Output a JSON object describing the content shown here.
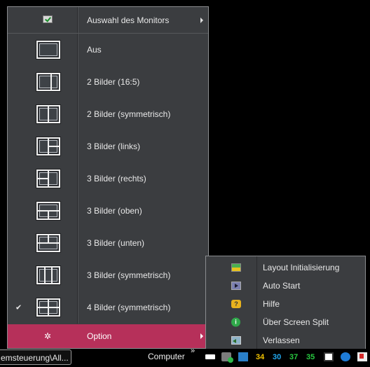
{
  "menu": {
    "header": {
      "label": "Auswahl des Monitors"
    },
    "items": [
      {
        "label": "Aus",
        "icon": "layout-off-icon",
        "checked": false
      },
      {
        "label": "2 Bilder (16:5)",
        "icon": "layout-2-wide-icon",
        "checked": false
      },
      {
        "label": "2 Bilder (symmetrisch)",
        "icon": "layout-2-sym-icon",
        "checked": false
      },
      {
        "label": "3 Bilder (links)",
        "icon": "layout-3-left-icon",
        "checked": false
      },
      {
        "label": "3 Bilder (rechts)",
        "icon": "layout-3-right-icon",
        "checked": false
      },
      {
        "label": "3 Bilder (oben)",
        "icon": "layout-3-top-icon",
        "checked": false
      },
      {
        "label": "3 Bilder (unten)",
        "icon": "layout-3-bottom-icon",
        "checked": false
      },
      {
        "label": "3 Bilder (symmetrisch)",
        "icon": "layout-3-sym-icon",
        "checked": false
      },
      {
        "label": "4 Bilder (symmetrisch)",
        "icon": "layout-4-sym-icon",
        "checked": true,
        "check_mark": "✔"
      }
    ],
    "option": {
      "label": "Option"
    },
    "colors": {
      "background": "#3b3d40",
      "highlight": "#b6305a"
    }
  },
  "submenu": {
    "items": [
      {
        "label": "Layout Initialisierung",
        "icon": "layout-init-icon"
      },
      {
        "label": "Auto Start",
        "icon": "play-icon"
      },
      {
        "label": "Hilfe",
        "icon": "help-icon"
      },
      {
        "label": "Über Screen Split",
        "icon": "info-icon"
      },
      {
        "label": "Verlassen",
        "icon": "exit-icon"
      }
    ]
  },
  "taskbar": {
    "task_label": "emsteuerung\\All...",
    "computer_label": "Computer",
    "overflow": "»",
    "tray_numbers": [
      {
        "value": "34",
        "color": "#f2c200"
      },
      {
        "value": "30",
        "color": "#21a8f0"
      },
      {
        "value": "37",
        "color": "#28c840"
      },
      {
        "value": "35",
        "color": "#28c840"
      }
    ]
  }
}
